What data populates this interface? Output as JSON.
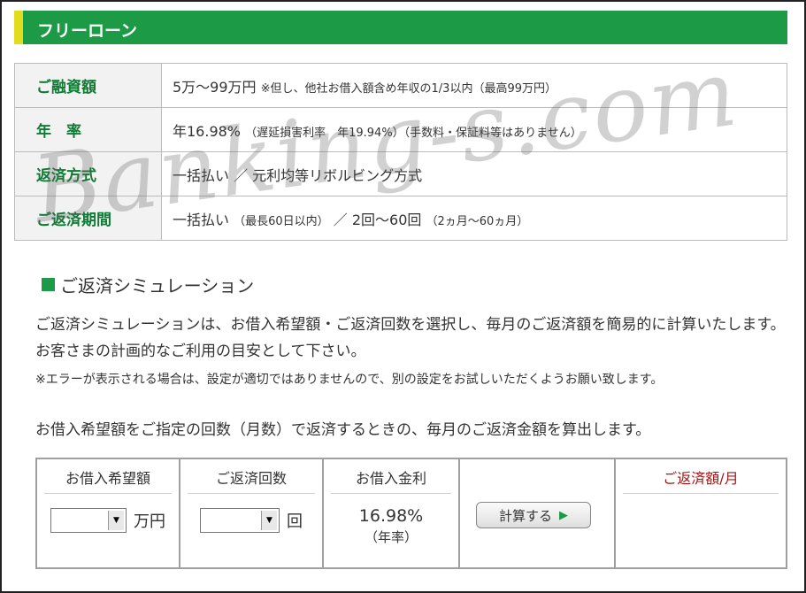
{
  "title": "フリーローン",
  "info_rows": [
    {
      "label": "ご融資額",
      "value": "5万～99万円",
      "note": "※但し、他社お借入額含め年収の1/3以内（最高99万円）"
    },
    {
      "label": "年　率",
      "value": "年16.98%",
      "note": "（遅延損害利率　年19.94%）（手数料・保証料等はありません）"
    },
    {
      "label": "返済方式",
      "value": "一括払い ／ 元利均等リボルビング方式",
      "note": ""
    },
    {
      "label": "ご返済期間",
      "value": "一括払い",
      "note": "（最長60日以内）",
      "value2": "／ 2回～60回",
      "note2": "（2ヵ月～60ヵ月）"
    }
  ],
  "simulation": {
    "heading": "ご返済シミュレーション",
    "desc1": "ご返済シミュレーションは、お借入希望額・ご返済回数を選択し、毎月のご返済額を簡易的に計算いたします。お客さまの計画的なご利用の目安として下さい。",
    "desc2": "※エラーが表示される場合は、設定が適切ではありませんので、別の設定をお試しいただくようお願い致します。",
    "desc3": "お借入希望額をご指定の回数（月数）で返済するときの、毎月のご返済金額を算出します。",
    "col_amount": "お借入希望額",
    "col_count": "ご返済回数",
    "col_rate": "お借入金利",
    "col_result": "ご返済額/月",
    "amount_unit": "万円",
    "count_unit": "回",
    "rate_value": "16.98%",
    "rate_sub": "（年率）",
    "calc_label": "計算する",
    "amount_value": "",
    "count_value": ""
  },
  "watermark": "Banking-s.com",
  "colors": {
    "accent_green": "#1c9a46",
    "accent_yellow": "#e3dc1e",
    "result_red": "#a41616"
  }
}
